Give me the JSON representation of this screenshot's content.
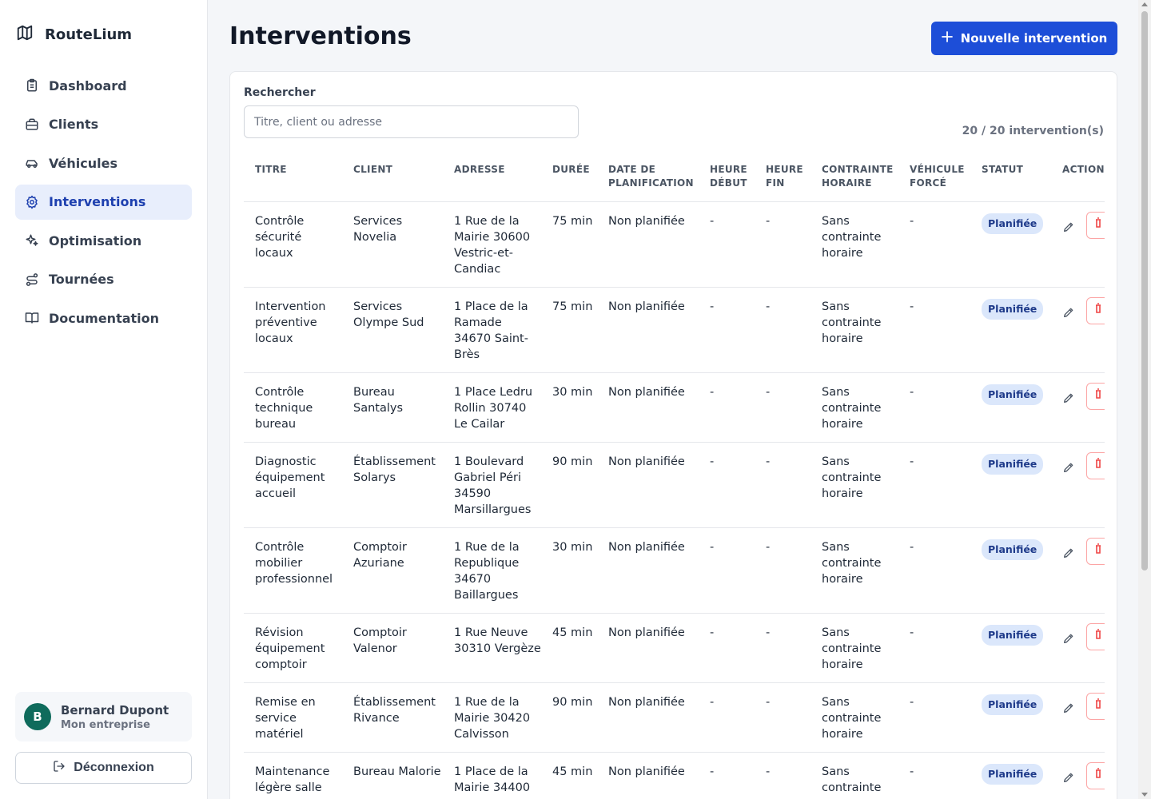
{
  "app": {
    "name": "RouteLium"
  },
  "sidebar": {
    "items": [
      {
        "label": "Dashboard",
        "icon": "clipboard-icon",
        "active": false
      },
      {
        "label": "Clients",
        "icon": "briefcase-icon",
        "active": false
      },
      {
        "label": "Véhicules",
        "icon": "car-icon",
        "active": false
      },
      {
        "label": "Interventions",
        "icon": "gear-icon",
        "active": true
      },
      {
        "label": "Optimisation",
        "icon": "sparkle-icon",
        "active": false
      },
      {
        "label": "Tournées",
        "icon": "route-icon",
        "active": false
      },
      {
        "label": "Documentation",
        "icon": "book-icon",
        "active": false
      }
    ],
    "user": {
      "initial": "B",
      "name": "Bernard Dupont",
      "company": "Mon entreprise"
    },
    "logout_label": "Déconnexion"
  },
  "main": {
    "title": "Interventions",
    "new_button_label": "Nouvelle intervention",
    "search": {
      "label": "Rechercher",
      "placeholder": "Titre, client ou adresse",
      "value": ""
    },
    "count": "20 / 20 intervention(s)",
    "columns": [
      "TITRE",
      "CLIENT",
      "ADRESSE",
      "DURÉE",
      "DATE DE PLANIFICATION",
      "HEURE DÉBUT",
      "HEURE FIN",
      "CONTRAINTE HORAIRE",
      "VÉHICULE FORCÉ",
      "STATUT",
      "ACTIONS"
    ],
    "rows": [
      {
        "titre": "Contrôle sécurité locaux",
        "client": "Services Novelia",
        "adresse": "1 Rue de la Mairie 30600 Vestric-et-Candiac",
        "duree": "75 min",
        "date": "Non planifiée",
        "debut": "-",
        "fin": "-",
        "contrainte": "Sans contrainte horaire",
        "vehicule": "-",
        "statut": "Planifiée"
      },
      {
        "titre": "Intervention préventive locaux",
        "client": "Services Olympe Sud",
        "adresse": "1 Place de la Ramade 34670 Saint-Brès",
        "duree": "75 min",
        "date": "Non planifiée",
        "debut": "-",
        "fin": "-",
        "contrainte": "Sans contrainte horaire",
        "vehicule": "-",
        "statut": "Planifiée"
      },
      {
        "titre": "Contrôle technique bureau",
        "client": "Bureau Santalys",
        "adresse": "1 Place Ledru Rollin 30740 Le Cailar",
        "duree": "30 min",
        "date": "Non planifiée",
        "debut": "-",
        "fin": "-",
        "contrainte": "Sans contrainte horaire",
        "vehicule": "-",
        "statut": "Planifiée"
      },
      {
        "titre": "Diagnostic équipement accueil",
        "client": "Établissement Solarys",
        "adresse": "1 Boulevard Gabriel Péri 34590 Marsillargues",
        "duree": "90 min",
        "date": "Non planifiée",
        "debut": "-",
        "fin": "-",
        "contrainte": "Sans contrainte horaire",
        "vehicule": "-",
        "statut": "Planifiée"
      },
      {
        "titre": "Contrôle mobilier professionnel",
        "client": "Comptoir Azuriane",
        "adresse": "1 Rue de la Republique 34670 Baillargues",
        "duree": "30 min",
        "date": "Non planifiée",
        "debut": "-",
        "fin": "-",
        "contrainte": "Sans contrainte horaire",
        "vehicule": "-",
        "statut": "Planifiée"
      },
      {
        "titre": "Révision équipement comptoir",
        "client": "Comptoir Valenor",
        "adresse": "1 Rue Neuve 30310 Vergèze",
        "duree": "45 min",
        "date": "Non planifiée",
        "debut": "-",
        "fin": "-",
        "contrainte": "Sans contrainte horaire",
        "vehicule": "-",
        "statut": "Planifiée"
      },
      {
        "titre": "Remise en service matériel",
        "client": "Établissement Rivance",
        "adresse": "1 Rue de la Mairie 30420 Calvisson",
        "duree": "90 min",
        "date": "Non planifiée",
        "debut": "-",
        "fin": "-",
        "contrainte": "Sans contrainte horaire",
        "vehicule": "-",
        "statut": "Planifiée"
      },
      {
        "titre": "Maintenance légère salle",
        "client": "Bureau Malorie",
        "adresse": "1 Place de la Mairie 34400",
        "duree": "45 min",
        "date": "Non planifiée",
        "debut": "-",
        "fin": "-",
        "contrainte": "Sans contrainte",
        "vehicule": "-",
        "statut": "Planifiée"
      }
    ]
  },
  "colors": {
    "primary": "#1d4ed8",
    "active_bg": "#e8eefc",
    "badge_bg": "#dbe7fb",
    "avatar": "#0f6b5c",
    "danger": "#ef4444"
  }
}
